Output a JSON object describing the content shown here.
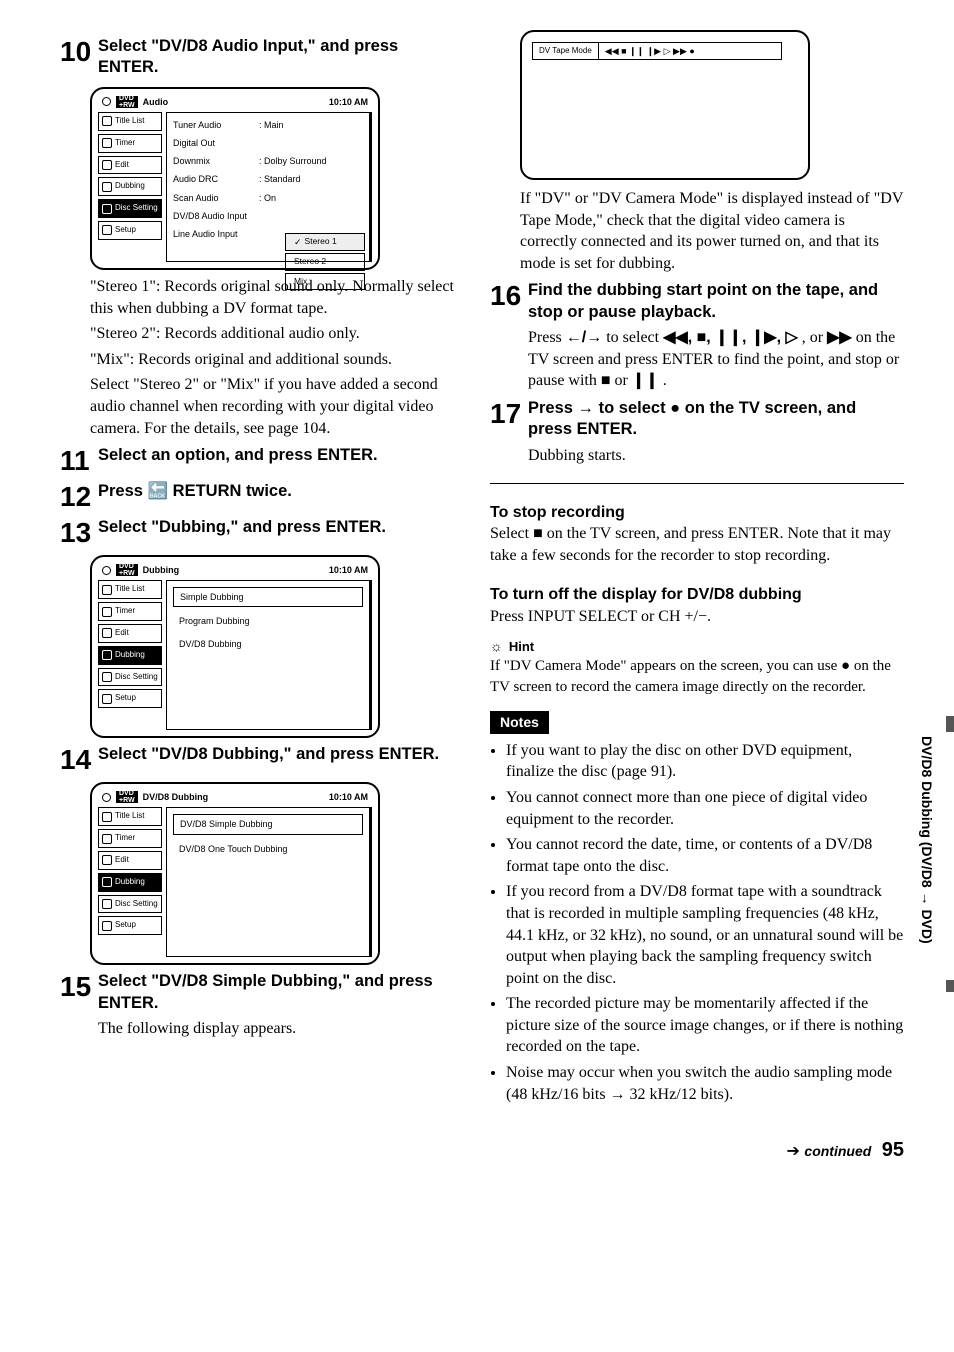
{
  "sideTab": "DV/D8 Dubbing (DV/D8 → DVD)",
  "footer": {
    "continued": "continued",
    "page": "95"
  },
  "left": {
    "step10": {
      "num": "10",
      "title": "Select \"DV/D8 Audio Input,\" and press ENTER.",
      "screen": {
        "headerTitle": "Audio",
        "clock": "10:10 AM",
        "sidebar": [
          "Title List",
          "Timer",
          "Edit",
          "Dubbing",
          "Disc Setting",
          "Setup"
        ],
        "activeSidebar": "Disc Setting",
        "rows": [
          {
            "k": "Tuner Audio",
            "v": ": Main"
          },
          {
            "k": "Digital Out",
            "v": ""
          },
          {
            "k": "Downmix",
            "v": ": Dolby Surround"
          },
          {
            "k": "Audio DRC",
            "v": ": Standard"
          },
          {
            "k": "Scan Audio",
            "v": ": On"
          },
          {
            "k": "DV/D8 Audio Input",
            "v": ""
          },
          {
            "k": "Line Audio Input",
            "v": ""
          }
        ],
        "options": [
          "Stereo 1",
          "Stereo 2",
          "Mix"
        ],
        "selectedOption": "Stereo 1"
      },
      "desc": [
        "\"Stereo 1\": Records original sound only. Normally select this when dubbing a DV format tape.",
        "\"Stereo 2\": Records additional audio only.",
        "\"Mix\": Records original and additional sounds.",
        "Select \"Stereo 2\" or \"Mix\" if you have added a second audio channel when recording with your digital video camera. For the details, see page 104."
      ]
    },
    "step11": {
      "num": "11",
      "title": "Select an option, and press ENTER."
    },
    "step12": {
      "num": "12",
      "title": "Press 🔙 RETURN twice."
    },
    "step13": {
      "num": "13",
      "title": "Select \"Dubbing,\" and press ENTER.",
      "screen": {
        "headerTitle": "Dubbing",
        "clock": "10:10 AM",
        "sidebar": [
          "Title List",
          "Timer",
          "Edit",
          "Dubbing",
          "Disc Setting",
          "Setup"
        ],
        "activeSidebar": "Dubbing",
        "list": [
          "Simple Dubbing",
          "Program Dubbing",
          "DV/D8 Dubbing"
        ]
      }
    },
    "step14": {
      "num": "14",
      "title": "Select \"DV/D8 Dubbing,\" and press ENTER.",
      "screen": {
        "headerTitle": "DV/D8 Dubbing",
        "clock": "10:10 AM",
        "sidebar": [
          "Title List",
          "Timer",
          "Edit",
          "Dubbing",
          "Disc Setting",
          "Setup"
        ],
        "activeSidebar": "Dubbing",
        "list": [
          "DV/D8 Simple Dubbing",
          "DV/D8 One Touch Dubbing"
        ]
      }
    },
    "step15": {
      "num": "15",
      "title": "Select \"DV/D8 Simple Dubbing,\" and press ENTER.",
      "desc": "The following display appears."
    }
  },
  "right": {
    "tapeScreen": {
      "label": "DV Tape Mode",
      "icons": "◀◀  ■  ❙❙  ❙▶  ▷  ▶▶  ●"
    },
    "tapeDesc": "If \"DV\" or \"DV Camera Mode\" is displayed instead of \"DV Tape Mode,\" check that the digital video camera is correctly connected and its power turned on, and that its mode is set for dubbing.",
    "step16": {
      "num": "16",
      "title": "Find the dubbing start point on the tape, and stop or pause playback.",
      "line1a": "Press ",
      "line1b": " to select ",
      "line1c": ", or ",
      "line1d": " on the TV screen and press ENTER to find the point, and stop or pause with ",
      "line1e": " or ",
      "line1f": ".",
      "sym_lr": "←/→",
      "sym_set": "◀◀, ■, ❙❙, ❙▶, ▷",
      "sym_ff": "▶▶",
      "sym_stop": "■",
      "sym_pause": "❙❙"
    },
    "step17": {
      "num": "17",
      "titleA": "Press ",
      "titleArrow": "→",
      "titleB": " to select ",
      "titleRec": "●",
      "titleC": " on the TV screen, and press ENTER.",
      "desc": "Dubbing starts."
    },
    "stopHead": "To stop recording",
    "stopBodyA": "Select ",
    "stopSym": "■",
    "stopBodyB": " on the TV screen, and press ENTER. Note that it may take a few seconds for the recorder to stop recording.",
    "turnOffHead": "To turn off the display for DV/D8 dubbing",
    "turnOffBody": "Press INPUT SELECT or CH +/−.",
    "hintLabel": "Hint",
    "hintBodyA": "If \"DV Camera Mode\" appears on the screen, you can use ",
    "hintSym": "●",
    "hintBodyB": " on the TV screen to record the camera image directly on the recorder.",
    "notesLabel": "Notes",
    "notes": [
      "If you want to play the disc on other DVD equipment, finalize the disc (page 91).",
      "You cannot connect more than one piece of digital video equipment to the recorder.",
      "You cannot record the date, time, or contents of a DV/D8 format tape onto the disc.",
      "If you record from a DV/D8 format tape with a soundtrack that is recorded in multiple sampling frequencies (48 kHz, 44.1 kHz, or 32 kHz), no sound, or an unnatural sound will be output when playing back the sampling frequency switch point on the disc.",
      "The recorded picture may be momentarily affected if the picture size of the source image changes, or if there is nothing recorded on the tape.",
      "Noise may occur when you switch the audio sampling mode (48 kHz/16 bits → 32 kHz/12 bits)."
    ]
  }
}
